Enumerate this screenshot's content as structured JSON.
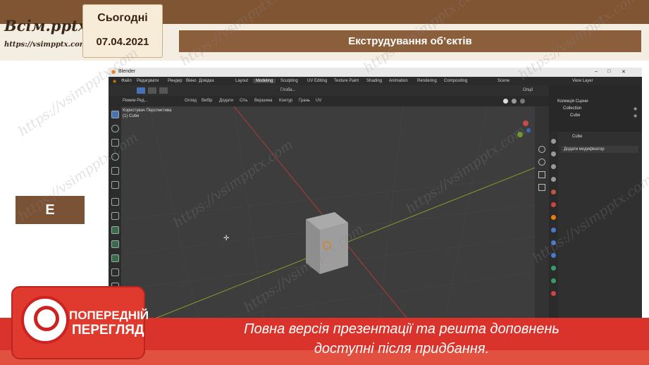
{
  "header": {
    "logo_text": "Всім.pptx",
    "logo_url": "https://vsimpptx.com",
    "date_label": "Сьогодні",
    "date_value": "07.04.2021",
    "slide_title": "Екструдування об’єктів",
    "letter_box": "E"
  },
  "blender": {
    "window_title": "Blender",
    "menu": [
      "Файл",
      "Редагувати",
      "Рендер",
      "Вікно",
      "Довідка"
    ],
    "workspaces": [
      "Layout",
      "Modeling",
      "Sculpting",
      "UV Editing",
      "Texture Paint",
      "Shading",
      "Animation",
      "Rendering",
      "Compositing"
    ],
    "active_workspace": "Modeling",
    "scene_label": "Scene",
    "view_layer_label": "View Layer",
    "transform_orientation": "Глоба...",
    "overlay_label": "Опції",
    "mode_select": "Режим Ред...",
    "header_menu": [
      "Огляд",
      "Вибір",
      "Додати",
      "Сіть",
      "Вершина",
      "Контур",
      "Грань",
      "UV"
    ],
    "viewport_info_line1": "Користувач Перспектива",
    "viewport_info_line2": "(1) Cube",
    "outliner": {
      "root": "Колекція Сцени",
      "collection": "Collection",
      "object": "Cube"
    },
    "properties": {
      "object_name": "Cube",
      "add_modifier": "Додати модифікатор"
    }
  },
  "preview": {
    "badge_line1": "ПОПЕРЕДНІЙ",
    "badge_line2": "ПЕРЕГЛЯД",
    "message_line1": "Повна версія презентації та решта доповнень",
    "message_line2": "доступні після придбання."
  },
  "colors": {
    "brand_brown": "#8b5e3c",
    "preview_red": "#d9332b",
    "blender_dark": "#1d1d1d",
    "axis_red": "#b23a3a",
    "axis_green": "#8a9a2a"
  }
}
